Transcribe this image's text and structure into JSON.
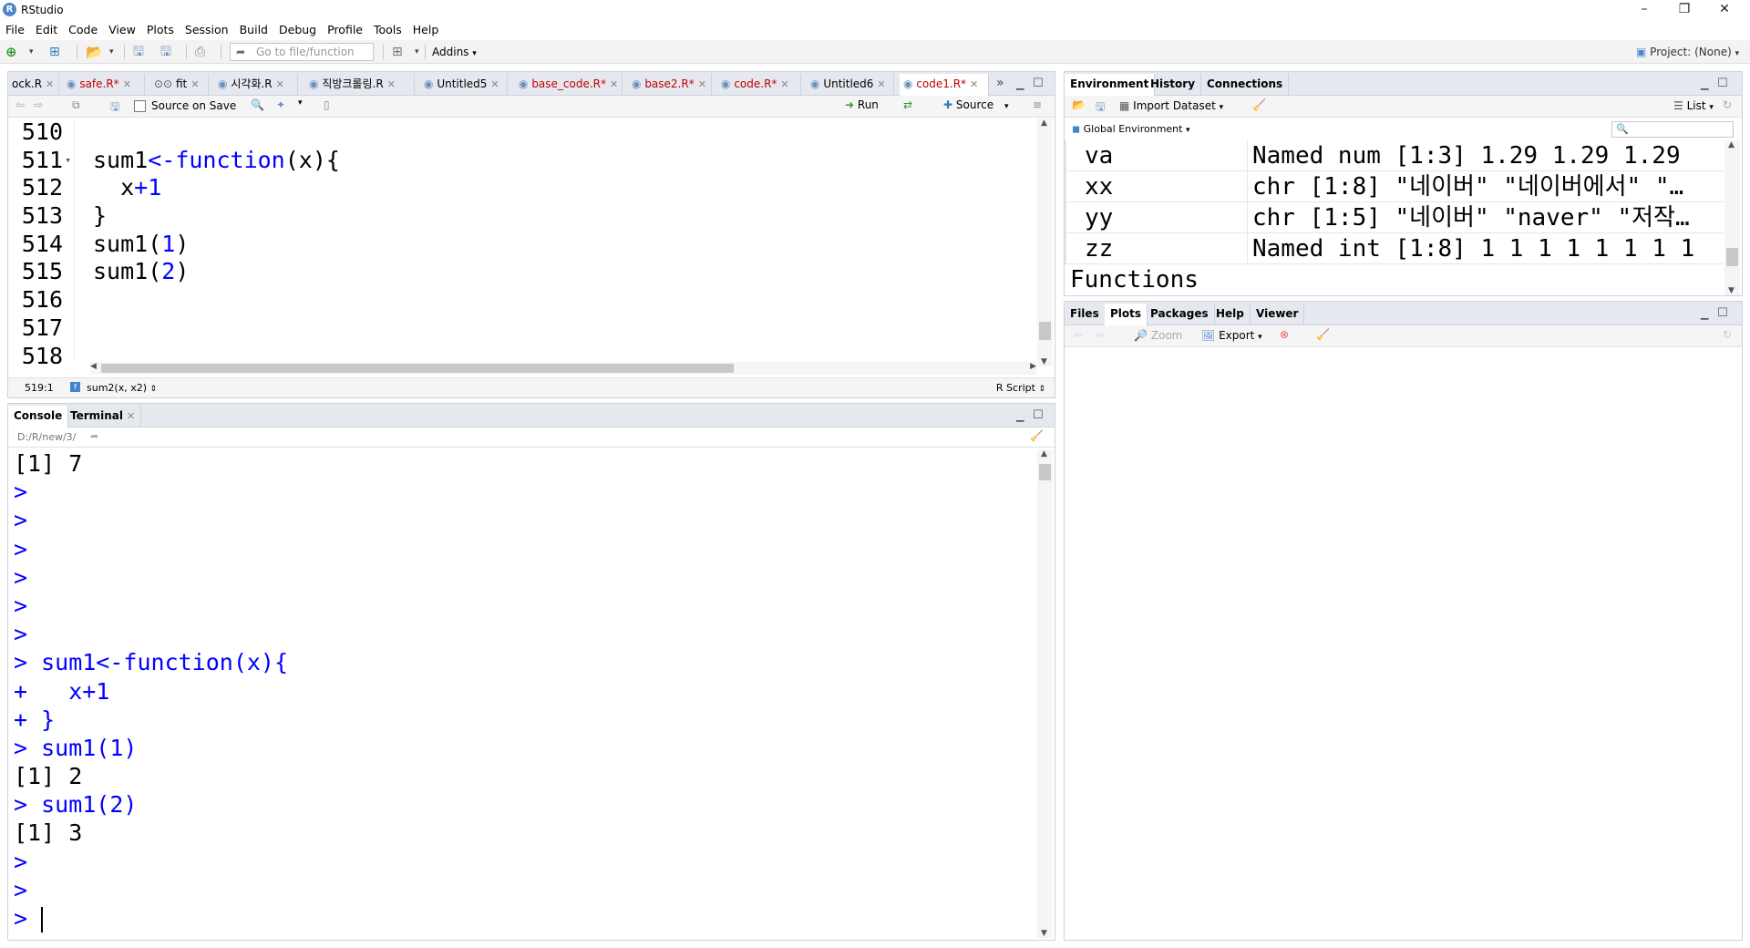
{
  "window": {
    "title": "RStudio",
    "logo": "R"
  },
  "menu": [
    "File",
    "Edit",
    "Code",
    "View",
    "Plots",
    "Session",
    "Build",
    "Debug",
    "Profile",
    "Tools",
    "Help"
  ],
  "toolbar": {
    "goto_placeholder": "Go to file/function",
    "addins": "Addins",
    "project": "Project: (None)"
  },
  "editor": {
    "tabs": [
      {
        "label": "ock.R",
        "color": "#000000"
      },
      {
        "label": "safe.R*",
        "color": "#c00000"
      },
      {
        "label": "fit",
        "color": "#000000"
      },
      {
        "label": "시각화.R",
        "color": "#000000"
      },
      {
        "label": "직방크롤링.R",
        "color": "#000000"
      },
      {
        "label": "Untitled5",
        "color": "#000000"
      },
      {
        "label": "base_code.R*",
        "color": "#c00000"
      },
      {
        "label": "base2.R*",
        "color": "#c00000"
      },
      {
        "label": "code.R*",
        "color": "#c00000"
      },
      {
        "label": "Untitled6",
        "color": "#000000"
      },
      {
        "label": "code1.R*",
        "color": "#c00000"
      }
    ],
    "source_on_save": "Source on Save",
    "run": "Run",
    "source": "Source",
    "line_numbers": [
      "510",
      "511",
      "512",
      "513",
      "514",
      "515",
      "516",
      "517",
      "518"
    ],
    "lines": [
      "",
      "sum1<-function(x){",
      "  x+1",
      "}",
      "sum1(1)",
      "sum1(2)",
      "",
      "",
      ""
    ],
    "status_pos": "519:1",
    "status_fn": "sum2(x, x2)",
    "status_type": "R Script"
  },
  "console": {
    "tabs": [
      "Console",
      "Terminal"
    ],
    "path": "D:/R/new/3/",
    "lines": [
      {
        "t": "[1] 7",
        "c": "out"
      },
      {
        "t": ">",
        "c": "prompt"
      },
      {
        "t": ">",
        "c": "prompt"
      },
      {
        "t": ">",
        "c": "prompt"
      },
      {
        "t": ">",
        "c": "prompt"
      },
      {
        "t": ">",
        "c": "prompt"
      },
      {
        "t": ">",
        "c": "prompt"
      },
      {
        "t": "> sum1<-function(x){",
        "c": "cmd"
      },
      {
        "t": "+   x+1",
        "c": "cmd"
      },
      {
        "t": "+ }",
        "c": "cmd"
      },
      {
        "t": "> sum1(1)",
        "c": "cmd"
      },
      {
        "t": "[1] 2",
        "c": "out"
      },
      {
        "t": "> sum1(2)",
        "c": "cmd"
      },
      {
        "t": "[1] 3",
        "c": "out"
      },
      {
        "t": ">",
        "c": "prompt"
      },
      {
        "t": ">",
        "c": "prompt"
      },
      {
        "t": ">",
        "c": "prompt"
      }
    ]
  },
  "environment": {
    "tabs": [
      "Environment",
      "History",
      "Connections"
    ],
    "import_dataset": "Import Dataset",
    "list": "List",
    "scope": "Global Environment",
    "rows": [
      {
        "name": "va",
        "value": "Named num [1:3] 1.29 1.29 1.29"
      },
      {
        "name": "xx",
        "value": "chr [1:8] \"네이버\" \"네이버에서\" \"…"
      },
      {
        "name": "yy",
        "value": "chr [1:5] \"네이버\" \"naver\" \"저작…"
      },
      {
        "name": "zz",
        "value": "Named int [1:8] 1 1 1 1 1 1 1 1"
      }
    ],
    "section": "Functions"
  },
  "files": {
    "tabs": [
      "Files",
      "Plots",
      "Packages",
      "Help",
      "Viewer"
    ],
    "zoom": "Zoom",
    "export": "Export"
  }
}
